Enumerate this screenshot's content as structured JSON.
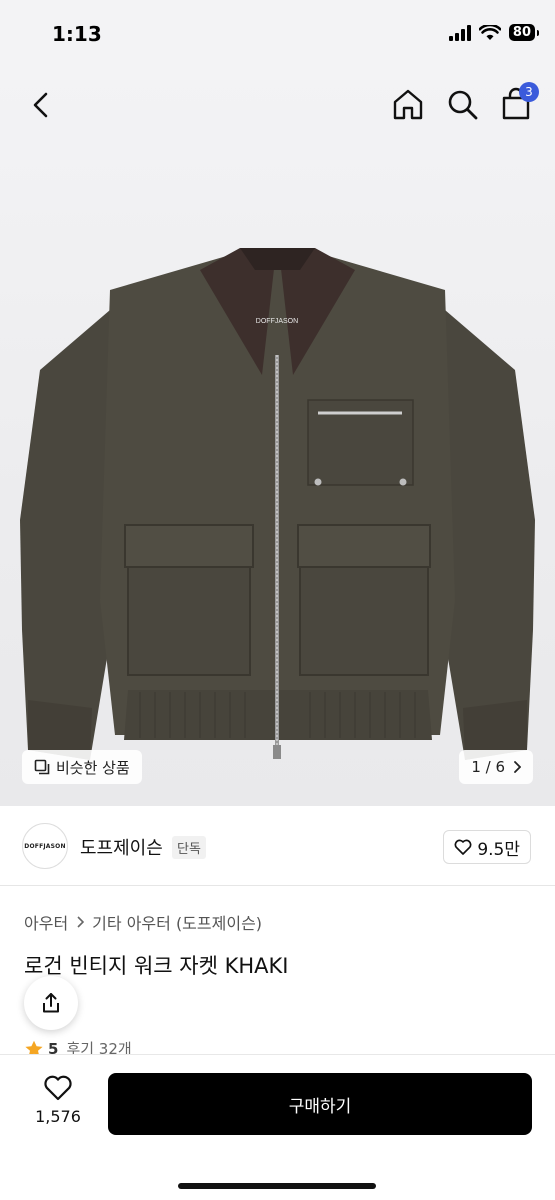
{
  "status_bar": {
    "time": "1:13",
    "battery": "80"
  },
  "nav": {
    "cart_count": "3"
  },
  "hero": {
    "similar_label": "비슷한 상품",
    "page_counter": "1 / 6",
    "jacket_label": "DOFFJASON"
  },
  "brand": {
    "logo_text": "DOFFJASON",
    "name": "도프제이슨",
    "tag": "단독",
    "likes": "9.5만"
  },
  "product": {
    "breadcrumb": [
      "아우터",
      "기타 아우터 (도프제이슨)"
    ],
    "title": "로건 빈티지 워크 자켓 KHAKI",
    "rating": "5",
    "review_count": "후기 32개"
  },
  "bottom_bar": {
    "wish_count": "1,576",
    "buy_label": "구매하기"
  },
  "colors": {
    "jacket": "#4d4a40",
    "collar": "#3d2f2c",
    "badge": "#3b5bdb",
    "buy_button": "#000000",
    "star": "#f5a623"
  }
}
